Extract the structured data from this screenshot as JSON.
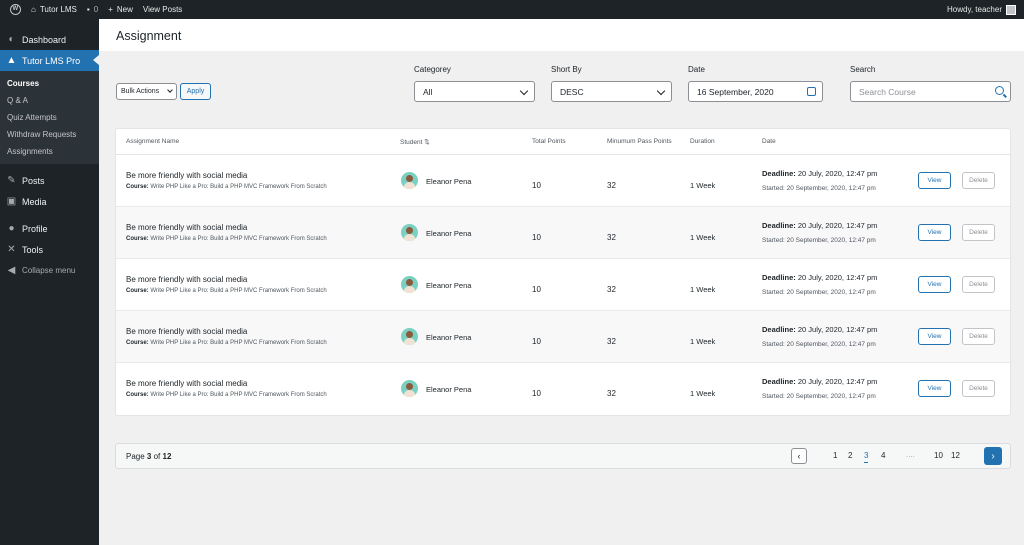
{
  "admin_bar": {
    "site_name": "Tutor LMS",
    "comments_count": "0",
    "new_label": "New",
    "view_posts": "View Posts",
    "howdy": "Howdy, teacher"
  },
  "sidebar": {
    "dashboard": "Dashboard",
    "tutor": "Tutor LMS Pro",
    "submenu": [
      "Courses",
      "Q & A",
      "Quiz Attempts",
      "Withdraw Requests",
      "Assignments"
    ],
    "posts": "Posts",
    "media": "Media",
    "profile": "Profile",
    "tools": "Tools",
    "collapse": "Collapse menu"
  },
  "page": {
    "title": "Assignment"
  },
  "filters": {
    "bulk_actions": "Bulk Actions",
    "apply": "Apply",
    "category_label": "Categorey",
    "category_value": "All",
    "sort_label": "Short By",
    "sort_value": "DESC",
    "date_label": "Date",
    "date_value": "16  September, 2020",
    "search_label": "Search",
    "search_placeholder": "Search Course"
  },
  "table": {
    "headers": {
      "name": "Assignment Name",
      "student": "Student",
      "total": "Total Points",
      "pass": "Minumum Pass Points",
      "duration": "Duration",
      "date": "Date"
    },
    "course_prefix": "Course:",
    "deadline_prefix": "Deadline:",
    "started_prefix": "Started:",
    "view_label": "View",
    "delete_label": "Delete",
    "rows": [
      {
        "name": "Be more friendly with social media",
        "course": "Write PHP Like a Pro: Build a PHP MVC Framework From Scratch",
        "student": "Eleanor Pena",
        "total": "10",
        "pass": "32",
        "duration": "1 Week",
        "deadline": "20 July, 2020, 12:47 pm",
        "started": "20 September, 2020, 12:47 pm"
      },
      {
        "name": "Be more friendly with social media",
        "course": "Write PHP Like a Pro: Build a PHP MVC Framework From Scratch",
        "student": "Eleanor Pena",
        "total": "10",
        "pass": "32",
        "duration": "1 Week",
        "deadline": "20 July, 2020, 12:47 pm",
        "started": "20 September, 2020, 12:47 pm"
      },
      {
        "name": "Be more friendly with social media",
        "course": "Write PHP Like a Pro: Build a PHP MVC Framework From Scratch",
        "student": "Eleanor Pena",
        "total": "10",
        "pass": "32",
        "duration": "1 Week",
        "deadline": "20 July, 2020, 12:47 pm",
        "started": "20 September, 2020, 12:47 pm"
      },
      {
        "name": "Be more friendly with social media",
        "course": "Write PHP Like a Pro: Build a PHP MVC Framework From Scratch",
        "student": "Eleanor Pena",
        "total": "10",
        "pass": "32",
        "duration": "1 Week",
        "deadline": "20 July, 2020, 12:47 pm",
        "started": "20 September, 2020, 12:47 pm"
      },
      {
        "name": "Be more friendly with social media",
        "course": "Write PHP Like a Pro: Build a PHP MVC Framework From Scratch",
        "student": "Eleanor Pena",
        "total": "10",
        "pass": "32",
        "duration": "1 Week",
        "deadline": "20 July, 2020, 12:47 pm",
        "started": "20 September, 2020, 12:47 pm"
      }
    ]
  },
  "pagination": {
    "page_word": "Page",
    "current": "3",
    "of_word": "of",
    "total": "12",
    "pages": [
      "1",
      "2",
      "3",
      "4",
      "10",
      "12"
    ],
    "dots": "....",
    "prev": "‹",
    "next": "›"
  }
}
